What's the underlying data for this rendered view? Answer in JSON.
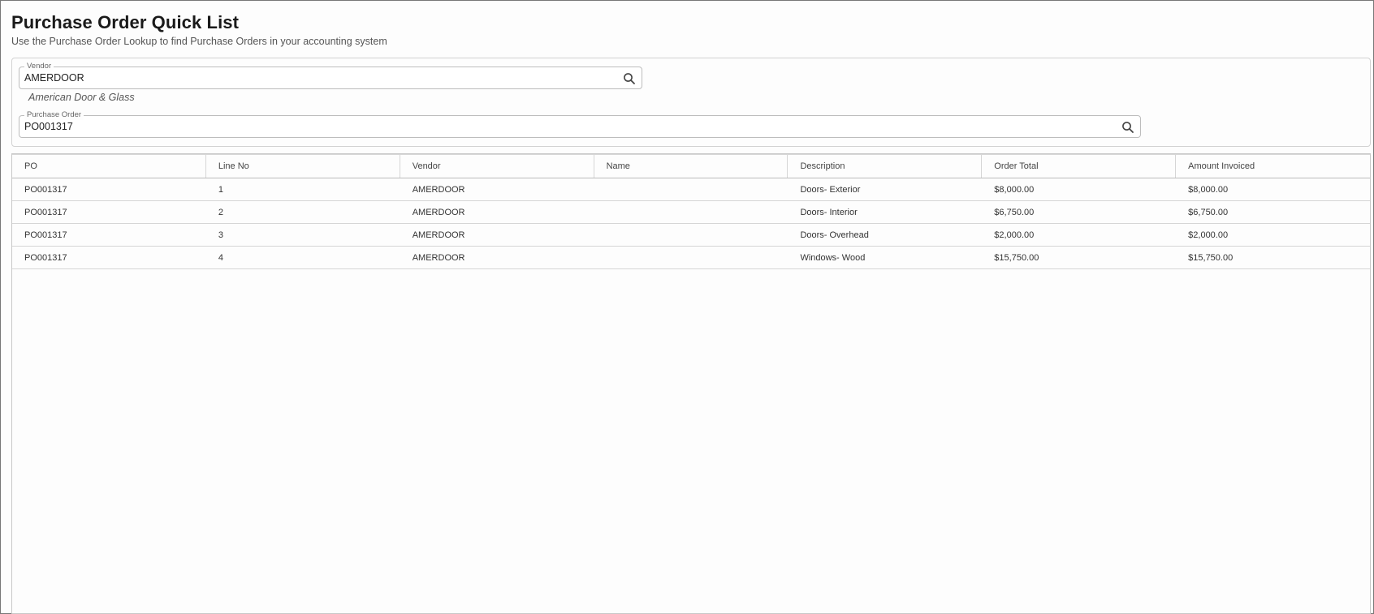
{
  "page": {
    "title": "Purchase Order Quick List",
    "subtitle": "Use the Purchase Order Lookup to find Purchase Orders in your accounting system"
  },
  "filters": {
    "vendor": {
      "label": "Vendor",
      "value": "AMERDOOR",
      "description": "American Door & Glass",
      "icon": "search-icon"
    },
    "purchase_order": {
      "label": "Purchase Order",
      "value": "PO001317",
      "icon": "search-icon"
    }
  },
  "grid": {
    "columns": [
      "PO",
      "Line No",
      "Vendor",
      "Name",
      "Description",
      "Order Total",
      "Amount Invoiced"
    ],
    "rows": [
      [
        "PO001317",
        "1",
        "AMERDOOR",
        "",
        "Doors- Exterior",
        "$8,000.00",
        "$8,000.00"
      ],
      [
        "PO001317",
        "2",
        "AMERDOOR",
        "",
        "Doors- Interior",
        "$6,750.00",
        "$6,750.00"
      ],
      [
        "PO001317",
        "3",
        "AMERDOOR",
        "",
        "Doors- Overhead",
        "$2,000.00",
        "$2,000.00"
      ],
      [
        "PO001317",
        "4",
        "AMERDOOR",
        "",
        "Windows- Wood",
        "$15,750.00",
        "$15,750.00"
      ]
    ]
  },
  "colors": {
    "background": "#fdfdfd",
    "border": "#d6d6d6",
    "text": "#333333"
  }
}
